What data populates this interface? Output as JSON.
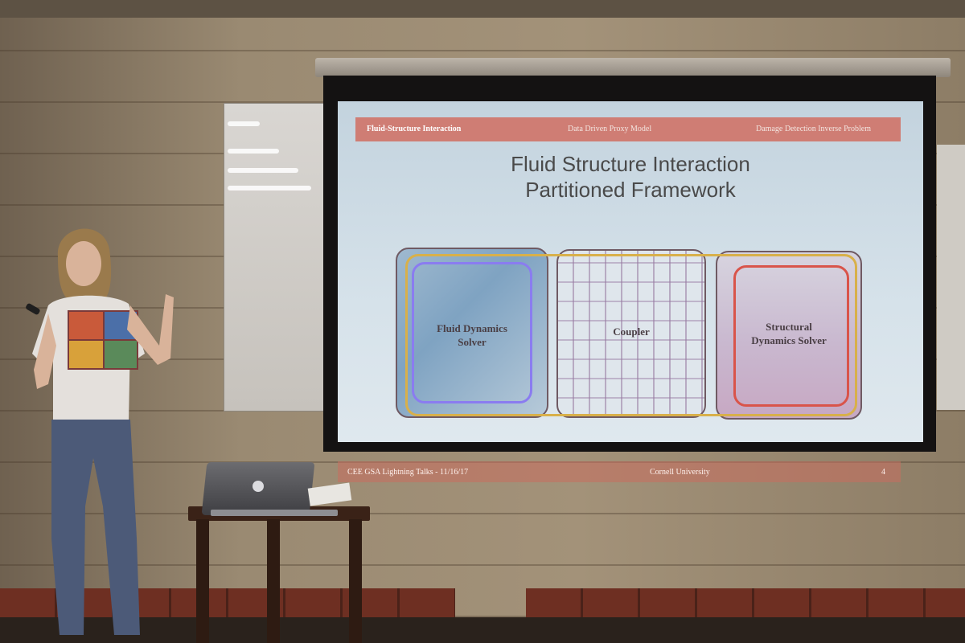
{
  "slide": {
    "header": {
      "section_active": "Fluid-Structure Interaction",
      "section_2": "Data Driven Proxy Model",
      "section_3": "Damage Detection Inverse Problem"
    },
    "title_line1": "Fluid Structure Interaction",
    "title_line2": "Partitioned Framework",
    "boxes": [
      {
        "label_line1": "Fluid Dynamics",
        "label_line2": "Solver",
        "loop_color": "#8a7cf0"
      },
      {
        "label_line1": "Coupler",
        "label_line2": "",
        "loop_color": "#9b7fa8"
      },
      {
        "label_line1": "Structural",
        "label_line2": "Dynamics Solver",
        "loop_color": "#d9544a"
      }
    ],
    "outer_loop_color": "#d8b04a",
    "footer": {
      "event": "CEE GSA Lightning Talks - 11/16/17",
      "institution": "Cornell University",
      "page_number": "4"
    }
  },
  "colors": {
    "slide_header": "#cf7d74",
    "slide_background": "#d6e2ea",
    "screen_frame": "#141212"
  }
}
